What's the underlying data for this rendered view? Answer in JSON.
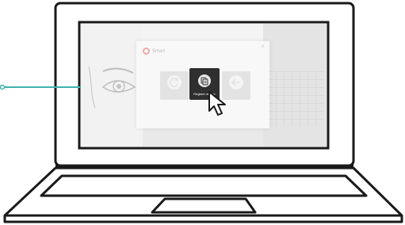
{
  "dialog": {
    "logo_text": "Smart",
    "close_glyph": "×",
    "tiles": [
      {
        "icon": "refresh-icon",
        "caption": "",
        "highlighted": false
      },
      {
        "icon": "register-device-icon",
        "caption": "Register device",
        "highlighted": true
      },
      {
        "icon": "logout-icon",
        "caption": "",
        "highlighted": false
      }
    ]
  },
  "colors": {
    "connector": "#3fb1b0",
    "highlight_tile": "#2f2f2f",
    "logo_accent": "#f0a8a8"
  }
}
